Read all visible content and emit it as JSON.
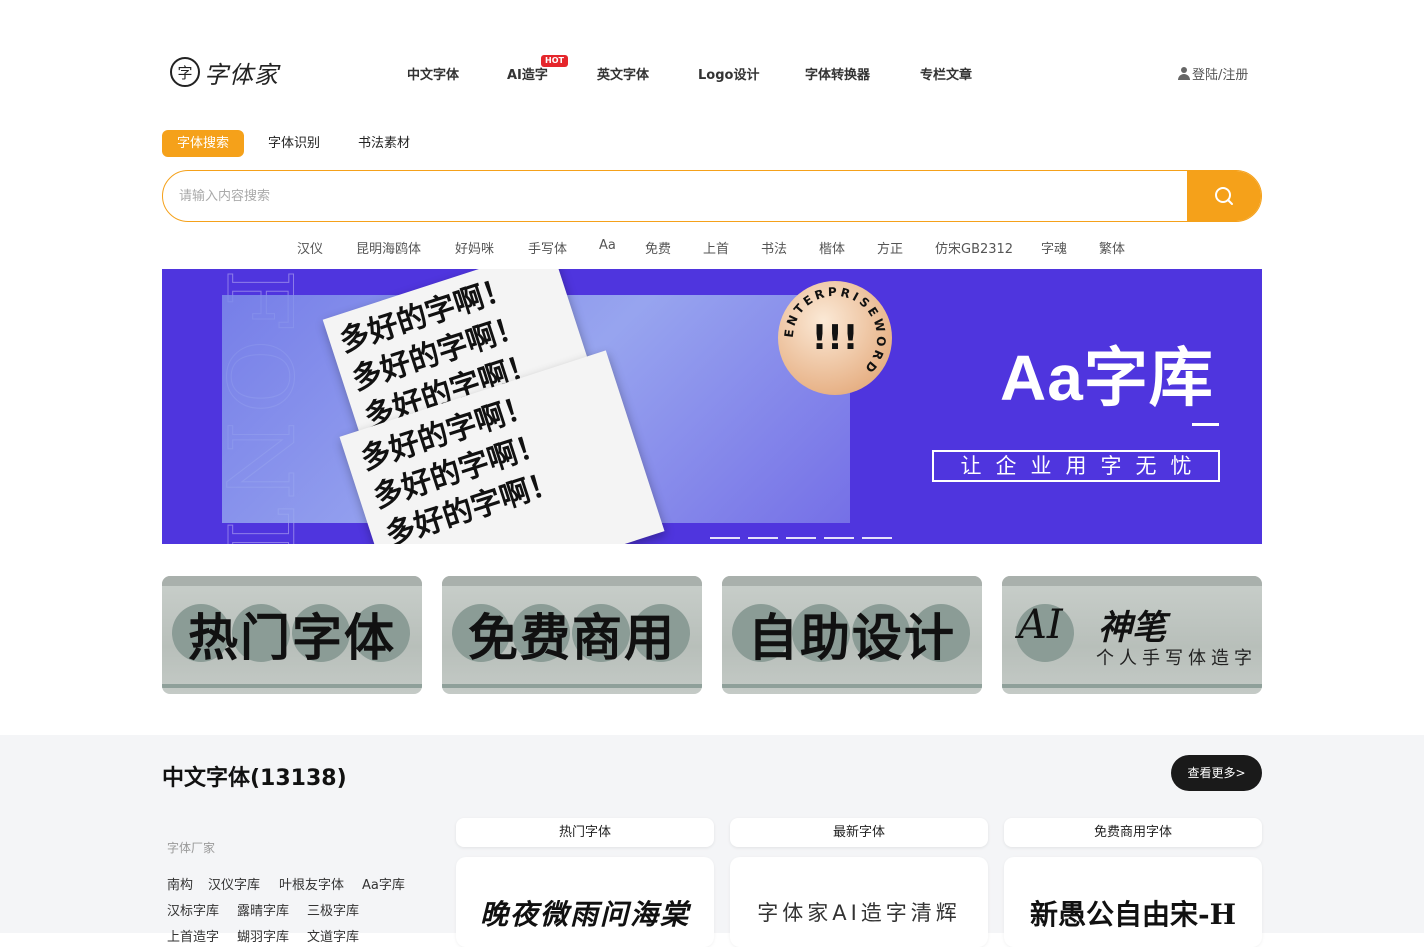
{
  "header": {
    "logo_mark": "字",
    "logo_text": "字体家",
    "nav": [
      {
        "label": "中文字体"
      },
      {
        "label": "AI造字",
        "badge": "HOT"
      },
      {
        "label": "英文字体"
      },
      {
        "label": "Logo设计"
      },
      {
        "label": "字体转换器"
      },
      {
        "label": "专栏文章"
      }
    ],
    "login_label": "登陆/注册"
  },
  "search": {
    "tabs": [
      "字体搜索",
      "字体识别",
      "书法素材"
    ],
    "active_tab": 0,
    "placeholder": "请输入内容搜索",
    "value": "",
    "hot_tags": [
      "汉仪",
      "昆明海鸥体",
      "好妈咪",
      "手写体",
      "Aa",
      "免费",
      "上首",
      "书法",
      "楷体",
      "方正",
      "仿宋GB2312",
      "字魂",
      "繁体"
    ]
  },
  "banner": {
    "paper_lines": [
      "多好的字啊！",
      "多好的字啊！",
      "多好的字啊！",
      "多好的字啊！",
      "多好的字啊！",
      "多好的字啊！"
    ],
    "badge_ring_text": "ENTERPRISEWORD",
    "badge_mark": "!!!",
    "title": "Aa字库",
    "subtitle": "让企业用字无忧",
    "slide_count": 5,
    "bg_color": "#4f35de",
    "accent_color": "#f5a11a"
  },
  "categories": [
    {
      "label": "热门字体"
    },
    {
      "label": "免费商用"
    },
    {
      "label": "自助设计"
    },
    {
      "title": "AI",
      "bold": "神笔",
      "subtitle": "个人手写体造字"
    }
  ],
  "chinese_fonts": {
    "title": "中文字体(13138)",
    "more_label": "查看更多>",
    "maker_label": "字体厂家",
    "makers": [
      [
        "南构",
        "汉仪字库",
        "叶根友字体",
        "Aa字库"
      ],
      [
        "汉标字库",
        "露晴字库",
        "三极字库"
      ],
      [
        "上首造字",
        "蝴羽字库",
        "文道字库"
      ]
    ],
    "columns": [
      {
        "label": "热门字体",
        "preview": "晚夜微雨问海棠"
      },
      {
        "label": "最新字体",
        "preview": "字体家AI造字清辉"
      },
      {
        "label": "免费商用字体",
        "preview": "新愚公自由宋-H"
      }
    ]
  }
}
